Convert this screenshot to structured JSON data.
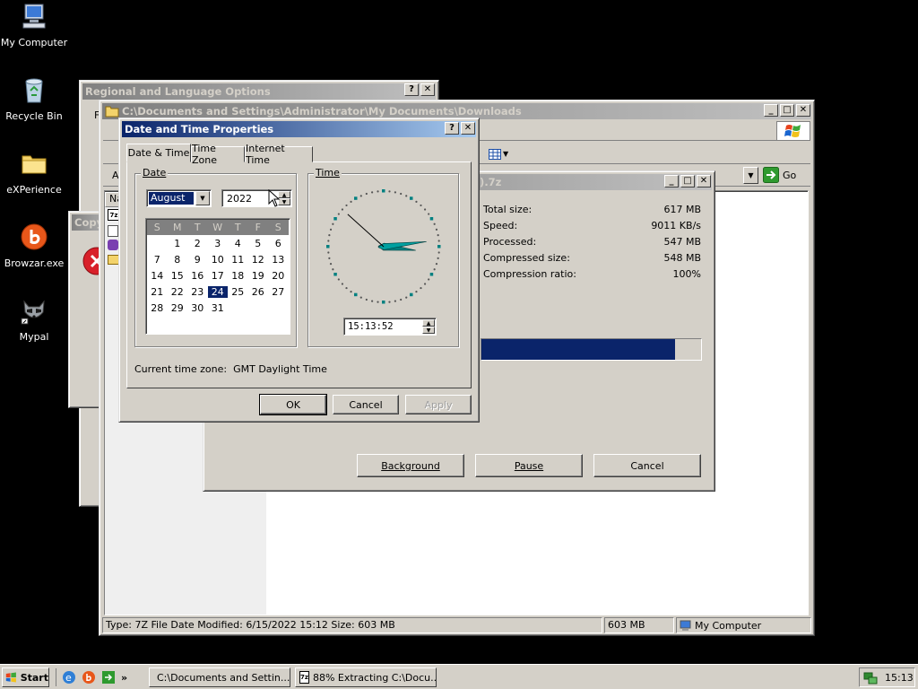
{
  "desktop": {
    "icons": [
      {
        "label": "My Computer"
      },
      {
        "label": "Recycle Bin"
      },
      {
        "label": "eXPerience"
      },
      {
        "label": "Browzar.exe"
      },
      {
        "label": "Mypal"
      }
    ]
  },
  "regional": {
    "title": "Regional and Language Options",
    "peek": "F"
  },
  "copy_dialog": {
    "title": "Copy"
  },
  "explorer": {
    "title": "C:\\Documents and Settings\\Administrator\\My Documents\\Downloads",
    "address_label": "A",
    "go_label": "Go",
    "col_name": "Na",
    "status": {
      "info": "Type: 7Z File Date Modified: 6/15/2022 15:12 Size: 603 MB",
      "size": "603 MB",
      "location": "My Computer"
    }
  },
  "extract": {
    "title_tail": "eta).7z",
    "stats": [
      {
        "label": "Total size:",
        "value": "617 MB"
      },
      {
        "label": "Speed:",
        "value": "9011 KB/s"
      },
      {
        "label": "Processed:",
        "value": "547 MB"
      },
      {
        "label": "Compressed size:",
        "value": "548 MB"
      },
      {
        "label": "Compression ratio:",
        "value": "100%"
      }
    ],
    "progress": 0.88,
    "buttons": {
      "background": "Background",
      "pause": "Pause",
      "cancel": "Cancel"
    }
  },
  "datetime": {
    "title": "Date and Time Properties",
    "tabs": [
      "Date & Time",
      "Time Zone",
      "Internet Time"
    ],
    "date_group": "Date",
    "time_group": "Time",
    "month": "August",
    "year": "2022",
    "weekdays": [
      "S",
      "M",
      "T",
      "W",
      "T",
      "F",
      "S"
    ],
    "weeks": [
      [
        "",
        "1",
        "2",
        "3",
        "4",
        "5",
        "6"
      ],
      [
        "7",
        "8",
        "9",
        "10",
        "11",
        "12",
        "13"
      ],
      [
        "14",
        "15",
        "16",
        "17",
        "18",
        "19",
        "20"
      ],
      [
        "21",
        "22",
        "23",
        "24",
        "25",
        "26",
        "27"
      ],
      [
        "28",
        "29",
        "30",
        "31",
        "",
        "",
        ""
      ]
    ],
    "selected_day": "24",
    "time": "15:13:52",
    "clock": {
      "hour": 15,
      "minute": 13,
      "second": 52
    },
    "timezone_label": "Current time zone:",
    "timezone": "GMT Daylight Time",
    "ok": "OK",
    "cancel": "Cancel",
    "apply": "Apply"
  },
  "taskbar": {
    "start": "Start",
    "tasks": [
      {
        "label": "C:\\Documents and Settin..."
      },
      {
        "label": "88% Extracting C:\\Docu..."
      }
    ],
    "clock": "15:13",
    "chevron": "»"
  },
  "colors": {
    "accent": "#0a246a",
    "face": "#d4d0c8",
    "progress": "#0a246a"
  }
}
